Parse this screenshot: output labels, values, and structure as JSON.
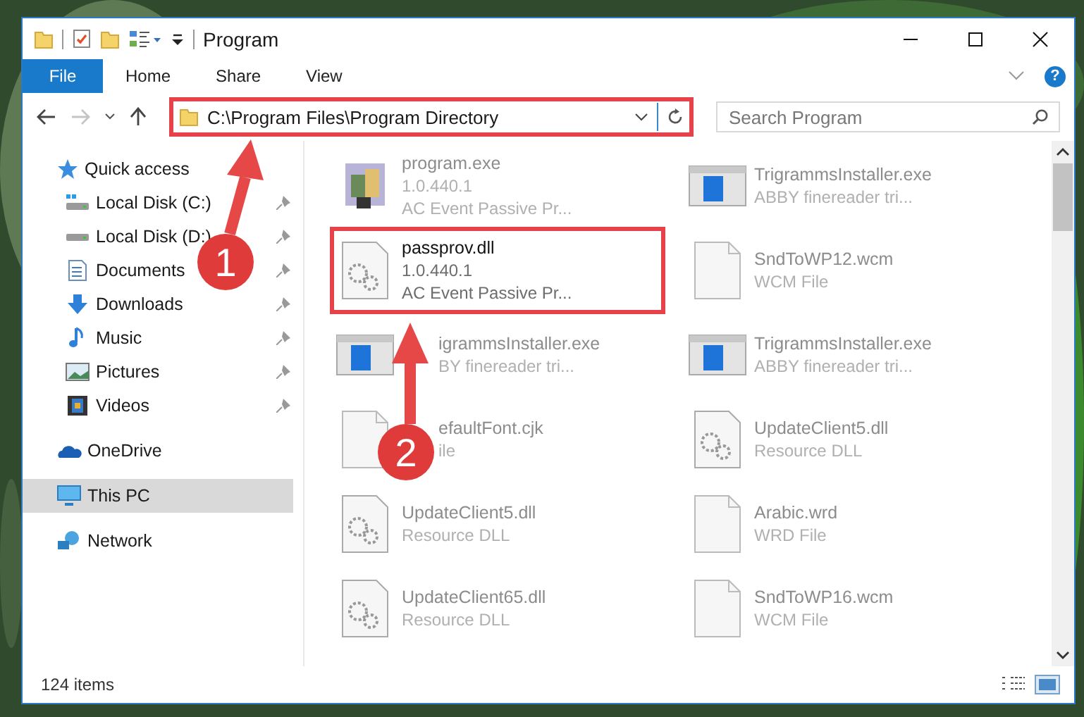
{
  "window": {
    "title": "Program"
  },
  "ribbon": {
    "tabs": [
      {
        "label": "File",
        "selected": true
      },
      {
        "label": "Home",
        "selected": false
      },
      {
        "label": "Share",
        "selected": false
      },
      {
        "label": "View",
        "selected": false
      }
    ],
    "help": "?"
  },
  "navigation": {
    "forward_disabled": true
  },
  "address": {
    "path": "C:\\Program Files\\Program Directory",
    "highlighted": true
  },
  "search": {
    "placeholder": "Search Program"
  },
  "sidebar": {
    "items": [
      {
        "label": "Quick access",
        "kind": "star",
        "selected": false,
        "children": [
          {
            "label": "Local Disk (C:)",
            "kind": "system-drive",
            "pinned": true,
            "selected": false
          },
          {
            "label": "Local Disk (D:)",
            "kind": "drive",
            "pinned": true,
            "selected": false
          },
          {
            "label": "Documents",
            "kind": "documents",
            "pinned": true,
            "selected": false
          },
          {
            "label": "Downloads",
            "kind": "downloads",
            "pinned": true,
            "selected": false
          },
          {
            "label": "Music",
            "kind": "music",
            "pinned": true,
            "selected": false
          },
          {
            "label": "Pictures",
            "kind": "pictures",
            "pinned": true,
            "selected": false
          },
          {
            "label": "Videos",
            "kind": "videos",
            "pinned": true,
            "selected": false
          }
        ]
      },
      {
        "label": "OneDrive",
        "kind": "cloud",
        "selected": false
      },
      {
        "label": "This PC",
        "kind": "pc",
        "selected": true
      },
      {
        "label": "Network",
        "kind": "network",
        "selected": false
      }
    ]
  },
  "files": [
    {
      "name": "program.exe",
      "lines": [
        "1.0.440.1",
        "AC Event Passive Pr..."
      ],
      "kind": "app",
      "focused": false
    },
    {
      "name": "TrigrammsInstaller.exe",
      "lines": [
        "ABBY finereader tri..."
      ],
      "kind": "installer",
      "focused": false
    },
    {
      "name": "passprov.dll",
      "lines": [
        "1.0.440.1",
        "AC Event Passive Pr..."
      ],
      "kind": "dll",
      "focused": true
    },
    {
      "name": "SndToWP12.wcm",
      "lines": [
        "WCM File"
      ],
      "kind": "file",
      "focused": false
    },
    {
      "name": "igrammsInstaller.exe",
      "lines": [
        "BY finereader tri..."
      ],
      "kind": "installer",
      "focused": false
    },
    {
      "name": "TrigrammsInstaller.exe",
      "lines": [
        "ABBY finereader tri..."
      ],
      "kind": "installer",
      "focused": false
    },
    {
      "name": "efaultFont.cjk",
      "lines": [
        "ile"
      ],
      "kind": "file",
      "focused": false
    },
    {
      "name": "UpdateClient5.dll",
      "lines": [
        "Resource DLL"
      ],
      "kind": "dll",
      "focused": false
    },
    {
      "name": "UpdateClient5.dll",
      "lines": [
        "Resource DLL"
      ],
      "kind": "dll",
      "focused": false
    },
    {
      "name": "Arabic.wrd",
      "lines": [
        "WRD File"
      ],
      "kind": "file",
      "focused": false
    },
    {
      "name": "UpdateClient65.dll",
      "lines": [
        "Resource DLL"
      ],
      "kind": "dll",
      "focused": false
    },
    {
      "name": "SndToWP16.wcm",
      "lines": [
        "WCM File"
      ],
      "kind": "file",
      "focused": false
    }
  ],
  "status_bar": {
    "text": "124 items"
  },
  "callouts": [
    {
      "label": "1"
    },
    {
      "label": "2"
    }
  ]
}
